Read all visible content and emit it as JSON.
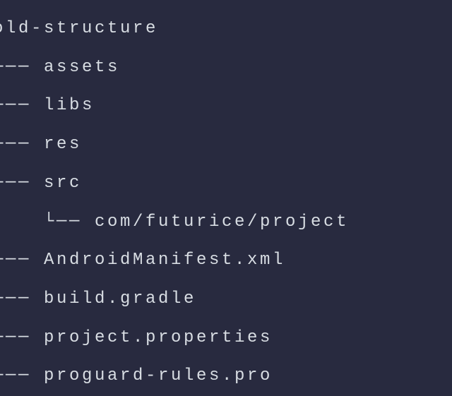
{
  "tree": {
    "lines": [
      "old-structure",
      "├── assets",
      "├── libs",
      "├── res",
      "├── src",
      "│   └── com/futurice/project",
      "├── AndroidManifest.xml",
      "├── build.gradle",
      "├── project.properties",
      "└── proguard-rules.pro"
    ]
  }
}
